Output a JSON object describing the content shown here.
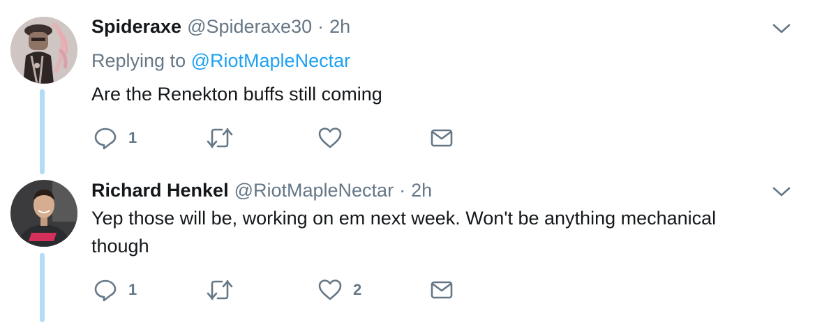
{
  "colors": {
    "text": "#14171a",
    "muted": "#657786",
    "link": "#1da1f2",
    "thread_line": "#b3dcf6"
  },
  "tweets": [
    {
      "name": "Spideraxe",
      "handle": "@Spideraxe30",
      "separator": "·",
      "time": "2h",
      "replying_prefix": "Replying to",
      "replying_to": "@RiotMapleNectar",
      "text": "Are the Renekton buffs still coming",
      "actions": {
        "reply_count": "1",
        "retweet_count": "",
        "like_count": "",
        "icons": [
          "reply-icon",
          "retweet-icon",
          "like-icon",
          "message-icon"
        ]
      }
    },
    {
      "name": "Richard Henkel",
      "handle": "@RiotMapleNectar",
      "separator": "·",
      "time": "2h",
      "text_line1": "Yep those will be, working on em next week. Won't be anything mechanical",
      "text_line2": "though",
      "actions": {
        "reply_count": "1",
        "retweet_count": "",
        "like_count": "2",
        "icons": [
          "reply-icon",
          "retweet-icon",
          "like-icon",
          "message-icon"
        ]
      }
    }
  ]
}
